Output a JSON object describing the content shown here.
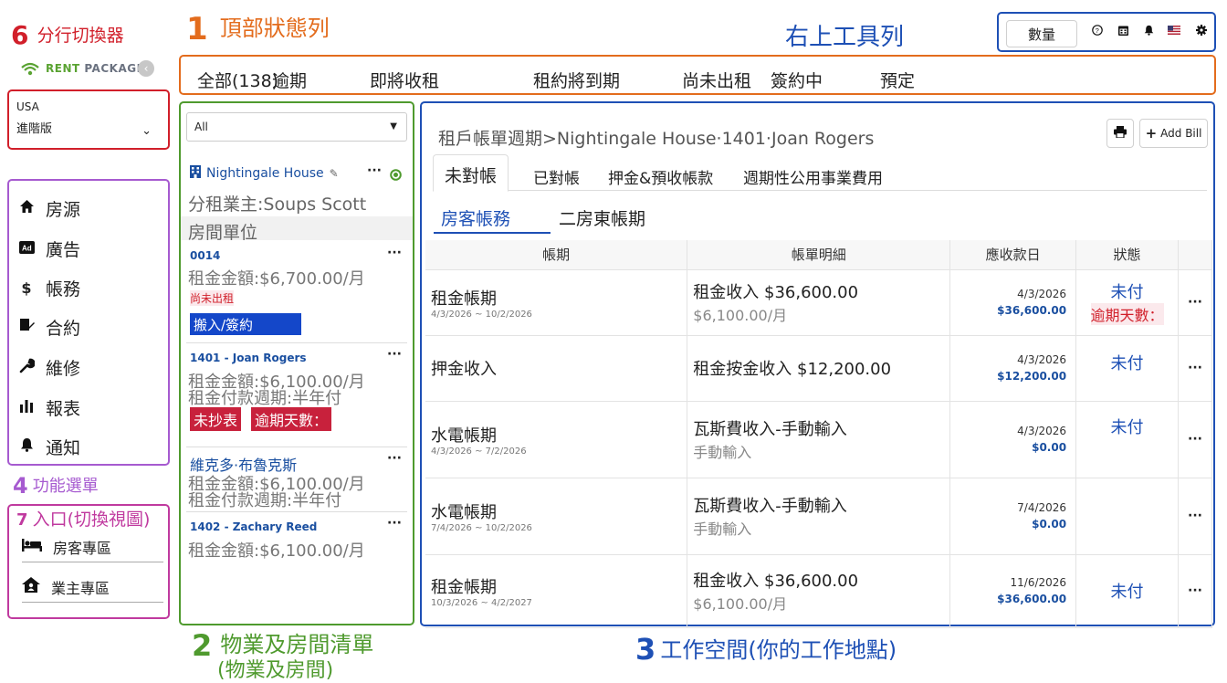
{
  "annotations": {
    "topbar": {
      "num": "1",
      "label": "頂部狀態列"
    },
    "toolbar": {
      "label": "右上工具列"
    },
    "branch": {
      "num": "6",
      "label": "分行切換器"
    },
    "menu": {
      "num": "4",
      "label": "功能選單"
    },
    "entry": {
      "num": "7",
      "label": "入口(切換視圖)"
    },
    "plist": {
      "num": "2",
      "label_line1": "物業及房間清單",
      "label_line2": "(物業及房間)"
    },
    "workspace": {
      "num": "3",
      "label": "工作空間(你的工作地點)"
    }
  },
  "brand": {
    "logo_part1": "RENT",
    "logo_part2": "PACKAGE"
  },
  "branch_switcher": {
    "country": "USA",
    "plan": "進階版"
  },
  "menu_items": [
    {
      "label": "房源",
      "icon": "home-icon"
    },
    {
      "label": "廣告",
      "icon": "ad-icon"
    },
    {
      "label": "帳務",
      "icon": "dollar-icon"
    },
    {
      "label": "合約",
      "icon": "contract-icon"
    },
    {
      "label": "維修",
      "icon": "wrench-icon"
    },
    {
      "label": "報表",
      "icon": "bar-chart-icon"
    },
    {
      "label": "通知",
      "icon": "bell-icon"
    }
  ],
  "entry_items": [
    {
      "label": "房客專區",
      "icon": "bed-icon"
    },
    {
      "label": "業主專區",
      "icon": "owner-house-icon"
    }
  ],
  "status_tabs": [
    "全部(138)",
    "逾期",
    "即將收租",
    "租約將到期",
    "尚未出租",
    "簽約中",
    "預定"
  ],
  "toolbar": {
    "quantity_label": "數量"
  },
  "property_list": {
    "filter_value": "All",
    "property_name": "Nightingale House",
    "sub_owner": "分租業主:Soups Scott",
    "rooms_header": "房間單位",
    "units": [
      {
        "title": "0014",
        "rent": "租金金額:$6,700.00/月",
        "status": "尚未出租",
        "action": "搬入/簽約"
      },
      {
        "title": "1401 - Joan Rogers",
        "rent": "租金金額:$6,100.00/月",
        "cycle": "租金付款週期:半年付",
        "tag1": "未抄表",
        "tag2": "逾期天數："
      },
      {
        "title": "維克多·布魯克斯",
        "rent": "租金金額:$6,100.00/月",
        "cycle": "租金付款週期:半年付"
      },
      {
        "title": "1402 - Zachary Reed",
        "rent": "租金金額:$6,100.00/月"
      }
    ]
  },
  "workspace": {
    "breadcrumb": "租戶帳單週期>Nightingale House·1401·Joan Rogers",
    "add_bill_label": "Add Bill",
    "tabs": [
      "未對帳",
      "已對帳",
      "押金&預收帳款",
      "週期性公用事業費用"
    ],
    "subtabs": [
      "房客帳務",
      "二房東帳期"
    ],
    "columns": [
      "帳期",
      "帳單明細",
      "應收款日",
      "狀態"
    ],
    "rows": [
      {
        "period": "租金帳期",
        "range": "4/3/2026 ~ 10/2/2026",
        "detail": "租金收入 $36,600.00",
        "detail_sub": "$6,100.00/月",
        "due_date": "4/3/2026",
        "due_amount": "$36,600.00",
        "status": "未付",
        "overdue": "逾期天數："
      },
      {
        "period": "押金收入",
        "range": "",
        "detail": "租金按金收入 $12,200.00",
        "detail_sub": "",
        "due_date": "4/3/2026",
        "due_amount": "$12,200.00",
        "status": "未付",
        "overdue": ""
      },
      {
        "period": "水電帳期",
        "range": "4/3/2026 ~ 7/2/2026",
        "detail": "瓦斯費收入-手動輸入",
        "detail_sub": "手動輸入",
        "due_date": "4/3/2026",
        "due_amount": "$0.00",
        "status": "未付",
        "overdue": ""
      },
      {
        "period": "水電帳期",
        "range": "7/4/2026 ~ 10/2/2026",
        "detail": "瓦斯費收入-手動輸入",
        "detail_sub": "手動輸入",
        "due_date": "7/4/2026",
        "due_amount": "$0.00",
        "status": "",
        "overdue": ""
      },
      {
        "period": "租金帳期",
        "range": "10/3/2026 ~ 4/2/2027",
        "detail": "租金收入 $36,600.00",
        "detail_sub": "$6,100.00/月",
        "due_date": "11/6/2026",
        "due_amount": "$36,600.00",
        "status": "未付",
        "overdue": ""
      }
    ]
  },
  "colors": {
    "topbar": "#e36c1d",
    "toolbar": "#1e50b5",
    "branch": "#d11f2a",
    "menu": "#a65ad0",
    "entry": "#c03a9f",
    "plist": "#4f9a2e",
    "workspace": "#1e50b5",
    "link": "#1a4fa0"
  }
}
